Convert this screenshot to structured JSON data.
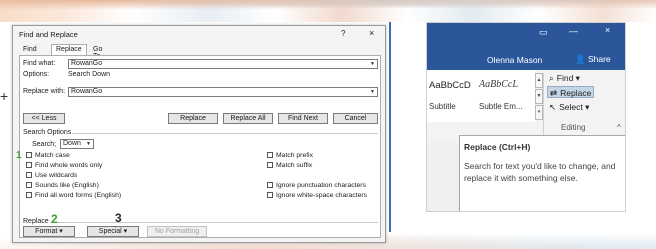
{
  "dialog": {
    "title": "Find and Replace",
    "help_glyph": "?",
    "close_glyph": "×",
    "tabs": [
      {
        "label": "Find"
      },
      {
        "label": "Replace"
      },
      {
        "label": "Go To"
      }
    ],
    "find_label": "Find what:",
    "find_value": "RowanGo",
    "options_label": "Options:",
    "options_value": "Search Down",
    "replace_label": "Replace with:",
    "replace_value": "RowanGo",
    "buttons": {
      "less": "<< Less",
      "replace": "Replace",
      "replace_all": "Replace All",
      "find_next": "Find Next",
      "cancel": "Cancel"
    },
    "search_options_label": "Search Options",
    "search_label": "Search;",
    "search_value": "Down",
    "checkboxes_left": [
      "Match case",
      "Find whole words only",
      "Use wildcards",
      "Sounds like (English)",
      "Find all word forms (English)"
    ],
    "checkboxes_right": [
      "Match prefix",
      "Match suffix",
      "Ignore punctuation characters",
      "Ignore white-space characters"
    ],
    "replace_section_label": "Replace",
    "format_button": "Format ▾",
    "special_button": "Special ▾",
    "no_formatting_button": "No Formatting",
    "callouts": [
      "1",
      "2",
      "3"
    ]
  },
  "ribbon": {
    "user_name": "Olenna Mason",
    "share_label": "Share",
    "style_samples": [
      {
        "sample": "AaBbCcD",
        "name": "Subtitle"
      },
      {
        "sample": "AaBbCcL",
        "name": "Subtle Em..."
      }
    ],
    "find_label": "Find",
    "replace_label": "Replace",
    "select_label": "Select",
    "group_label": "Editing",
    "tooltip_title": "Replace (Ctrl+H)",
    "tooltip_body": "Search for text you'd like to change, and replace it with something else."
  },
  "colors": {
    "ribbon_blue": "#2b579a",
    "callout_green": "#3aa32a",
    "highlight": "#c5d5e8"
  }
}
